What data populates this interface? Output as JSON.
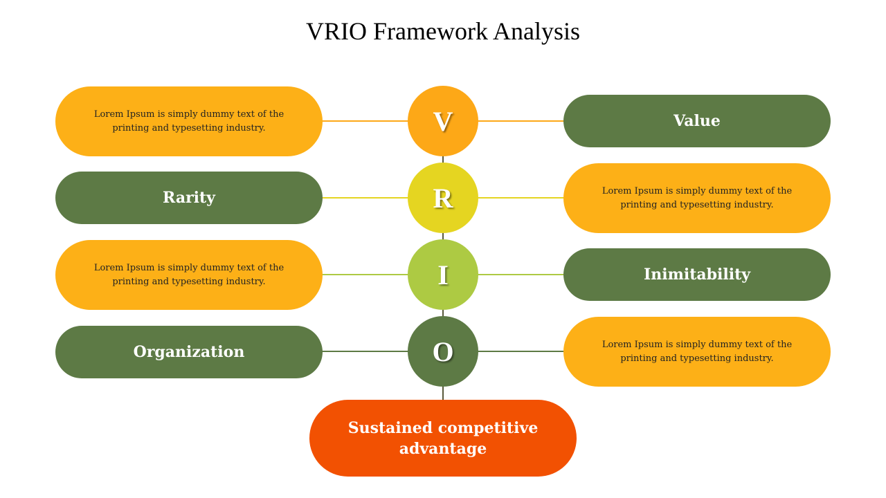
{
  "title": "VRIO Framework Analysis",
  "colors": {
    "text_pill": "#FDB017",
    "label_pill": "#5D7A45",
    "outcome_pill": "#F25102",
    "v_circle": "#FDA817",
    "r_circle": "#E5D521",
    "i_circle": "#ADCA43",
    "o_circle": "#5D7A45",
    "connector_vertical": "#5A5A3C"
  },
  "rows": [
    {
      "letter": "V",
      "left_text": "Lorem Ipsum is simply dummy text of the printing and typesetting industry.",
      "right_label": "Value"
    },
    {
      "letter": "R",
      "left_label": "Rarity",
      "right_text": "Lorem Ipsum is simply dummy text of the printing and typesetting industry."
    },
    {
      "letter": "I",
      "left_text": "Lorem Ipsum is simply dummy text of the printing and typesetting industry.",
      "right_label": "Inimitability"
    },
    {
      "letter": "O",
      "left_label": "Organization",
      "right_text": "Lorem Ipsum is simply dummy text of the printing and typesetting industry."
    }
  ],
  "outcome": "Sustained competitive advantage"
}
